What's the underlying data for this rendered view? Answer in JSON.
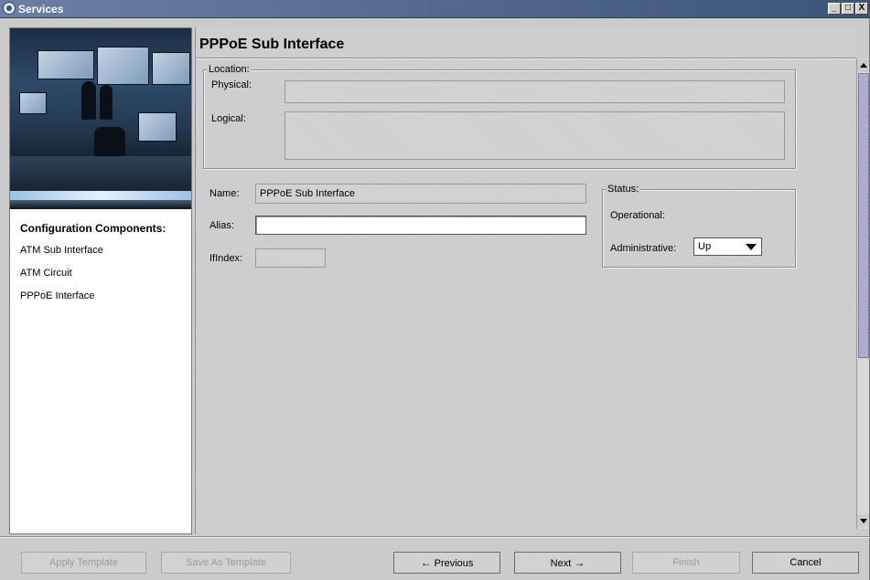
{
  "window": {
    "title": "Services",
    "controls": {
      "minimize": "_",
      "maximize": "□",
      "close": "X"
    }
  },
  "sidebar": {
    "heading": "Configuration Components:",
    "items": [
      {
        "label": "ATM Sub Interface"
      },
      {
        "label": "ATM Circuit"
      },
      {
        "label": "PPPoE Interface"
      }
    ]
  },
  "main": {
    "title": "PPPoE Sub Interface",
    "location": {
      "legend": "Location:",
      "physical_label": "Physical:",
      "physical_value": "",
      "logical_label": "Logical:",
      "logical_value": ""
    },
    "name": {
      "label": "Name:",
      "value": "PPPoE Sub Interface"
    },
    "alias": {
      "label": "Alias:",
      "value": ""
    },
    "ifindex": {
      "label": "IfIndex:",
      "value": ""
    },
    "status": {
      "legend": "Status:",
      "operational_label": "Operational:",
      "operational_value": "",
      "administrative_label": "Administrative:",
      "administrative_value": "Up"
    }
  },
  "buttons": {
    "apply_template": "Apply Template",
    "save_as_template": "Save As Template",
    "previous": "Previous",
    "next": "Next",
    "finish": "Finish",
    "cancel": "Cancel"
  },
  "icons": {
    "app": "services-icon",
    "previous_arrow": "←",
    "next_arrow": "→"
  }
}
